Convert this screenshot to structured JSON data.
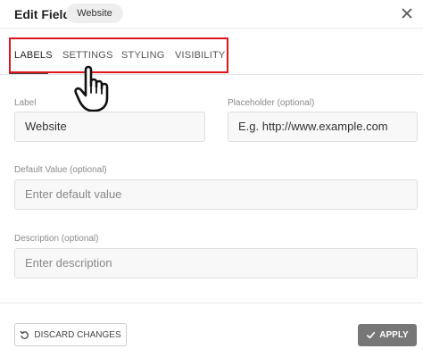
{
  "header": {
    "title": "Edit Field",
    "badge": "Website",
    "close_icon": "close-icon"
  },
  "tabs": [
    {
      "label": "LABELS",
      "active": true
    },
    {
      "label": "SETTINGS",
      "active": false
    },
    {
      "label": "STYLING",
      "active": false
    },
    {
      "label": "VISIBILITY",
      "active": false
    }
  ],
  "highlight_color": "#e0141f",
  "form": {
    "label": {
      "caption": "Label",
      "value": "Website"
    },
    "placeholder": {
      "caption": "Placeholder (optional)",
      "value": "E.g. http://www.example.com"
    },
    "default_value": {
      "caption": "Default Value (optional)",
      "placeholder": "Enter default value"
    },
    "description": {
      "caption": "Description (optional)",
      "placeholder": "Enter description"
    }
  },
  "footer": {
    "discard_label": "DISCARD CHANGES",
    "discard_icon": "undo-icon",
    "apply_label": "APPLY",
    "apply_icon": "check-icon"
  }
}
